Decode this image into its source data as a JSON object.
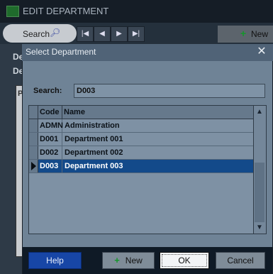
{
  "window": {
    "title": "EDIT DEPARTMENT"
  },
  "toolbar": {
    "search_label": "Search",
    "search_icon": "binoculars-icon",
    "nav_first": "|◀",
    "nav_prev": "◀",
    "nav_next": "▶",
    "nav_last": "▶|",
    "new_label": "New"
  },
  "background_form": {
    "label_1": "De",
    "label_2": "De",
    "panel_letter": "P"
  },
  "dialog": {
    "title": "Select Department",
    "close_glyph": "✕",
    "search": {
      "label": "Search:",
      "value": "D003"
    },
    "grid": {
      "columns": [
        "Code",
        "Name"
      ],
      "rows": [
        {
          "code": "ADMN",
          "name": "Administration"
        },
        {
          "code": "D001",
          "name": "Department 001"
        },
        {
          "code": "D002",
          "name": "Department 002"
        },
        {
          "code": "D003",
          "name": "Department 003"
        }
      ],
      "selected_index": 3
    },
    "buttons": {
      "help": "Help",
      "new": "New",
      "ok": "OK",
      "cancel": "Cancel"
    }
  },
  "colors": {
    "selection": "#134a8a",
    "help_button": "#1746a6",
    "plus_icon": "#14962a"
  }
}
